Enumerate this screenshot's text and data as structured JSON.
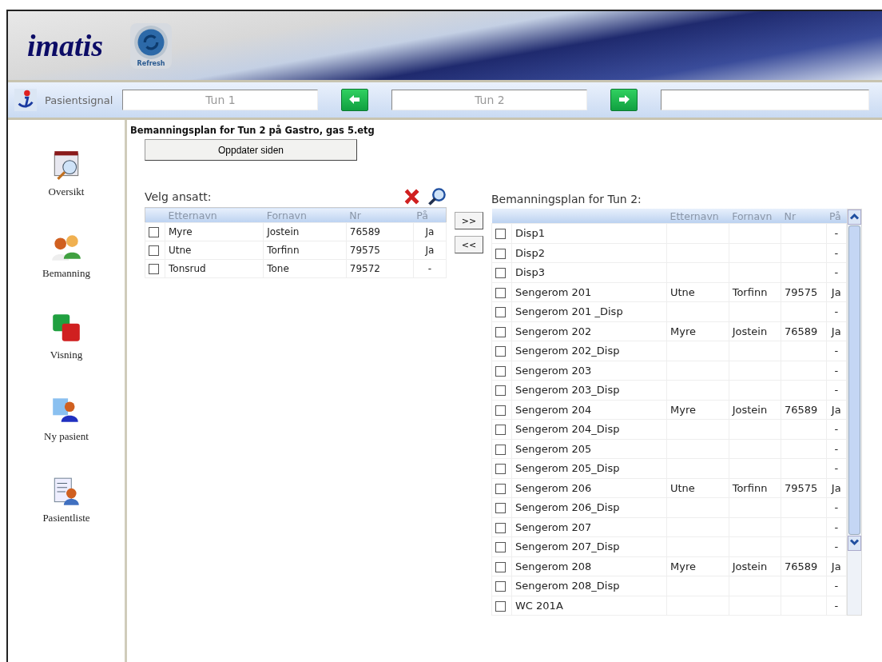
{
  "header": {
    "logo": "imatis",
    "refresh_label": "Refresh"
  },
  "toolbar": {
    "label": "Pasientsignal",
    "fields": [
      {
        "value": "Tun 1"
      },
      {
        "value": "Tun 2"
      }
    ]
  },
  "sidebar": {
    "items": [
      {
        "kind": "overview",
        "label": "Oversikt"
      },
      {
        "kind": "staff",
        "label": "Bemanning"
      },
      {
        "kind": "view",
        "label": "Visning"
      },
      {
        "kind": "newpatient",
        "label": "Ny pasient"
      },
      {
        "kind": "patientlist",
        "label": "Pasientliste"
      }
    ]
  },
  "page_title": "Bemanningsplan for Tun 2 på Gastro, gas 5.etg",
  "update_button": "Oppdater siden",
  "employees": {
    "title": "Velg ansatt:",
    "columns": [
      "Etternavn",
      "Fornavn",
      "Nr",
      "På"
    ],
    "rows": [
      {
        "checked": false,
        "cells": [
          "Myre",
          "Jostein",
          "76589",
          "Ja"
        ]
      },
      {
        "checked": false,
        "cells": [
          "Utne",
          "Torfinn",
          "79575",
          "Ja"
        ]
      },
      {
        "checked": false,
        "cells": [
          "Tonsrud",
          "Tone",
          "79572",
          "-"
        ]
      }
    ]
  },
  "move_buttons": [
    ">>",
    "<<"
  ],
  "plan": {
    "title": "Bemanningsplan for Tun 2:",
    "columns": [
      "",
      "Etternavn",
      "Fornavn",
      "Nr",
      "På"
    ],
    "rows": [
      {
        "checked": false,
        "cells": [
          "Disp1",
          "",
          "",
          "",
          "-"
        ]
      },
      {
        "checked": false,
        "cells": [
          "Disp2",
          "",
          "",
          "",
          "-"
        ]
      },
      {
        "checked": false,
        "cells": [
          "Disp3",
          "",
          "",
          "",
          "-"
        ]
      },
      {
        "checked": false,
        "cells": [
          "Sengerom 201",
          "Utne",
          "Torfinn",
          "79575",
          "Ja"
        ]
      },
      {
        "checked": false,
        "cells": [
          "Sengerom 201 _Disp",
          "",
          "",
          "",
          "-"
        ]
      },
      {
        "checked": false,
        "cells": [
          "Sengerom 202",
          "Myre",
          "Jostein",
          "76589",
          "Ja"
        ]
      },
      {
        "checked": false,
        "cells": [
          "Sengerom 202_Disp",
          "",
          "",
          "",
          "-"
        ]
      },
      {
        "checked": false,
        "cells": [
          "Sengerom 203",
          "",
          "",
          "",
          "-"
        ]
      },
      {
        "checked": false,
        "cells": [
          "Sengerom 203_Disp",
          "",
          "",
          "",
          "-"
        ]
      },
      {
        "checked": false,
        "cells": [
          "Sengerom 204",
          "Myre",
          "Jostein",
          "76589",
          "Ja"
        ]
      },
      {
        "checked": false,
        "cells": [
          "Sengerom 204_Disp",
          "",
          "",
          "",
          "-"
        ]
      },
      {
        "checked": false,
        "cells": [
          "Sengerom 205",
          "",
          "",
          "",
          "-"
        ]
      },
      {
        "checked": false,
        "cells": [
          "Sengerom 205_Disp",
          "",
          "",
          "",
          "-"
        ]
      },
      {
        "checked": false,
        "cells": [
          "Sengerom 206",
          "Utne",
          "Torfinn",
          "79575",
          "Ja"
        ]
      },
      {
        "checked": false,
        "cells": [
          "Sengerom 206_Disp",
          "",
          "",
          "",
          "-"
        ]
      },
      {
        "checked": false,
        "cells": [
          "Sengerom 207",
          "",
          "",
          "",
          "-"
        ]
      },
      {
        "checked": false,
        "cells": [
          "Sengerom 207_Disp",
          "",
          "",
          "",
          "-"
        ]
      },
      {
        "checked": false,
        "cells": [
          "Sengerom 208",
          "Myre",
          "Jostein",
          "76589",
          "Ja"
        ]
      },
      {
        "checked": false,
        "cells": [
          "Sengerom 208_Disp",
          "",
          "",
          "",
          "-"
        ]
      },
      {
        "checked": false,
        "cells": [
          "WC 201A",
          "",
          "",
          "",
          "-"
        ]
      }
    ]
  }
}
